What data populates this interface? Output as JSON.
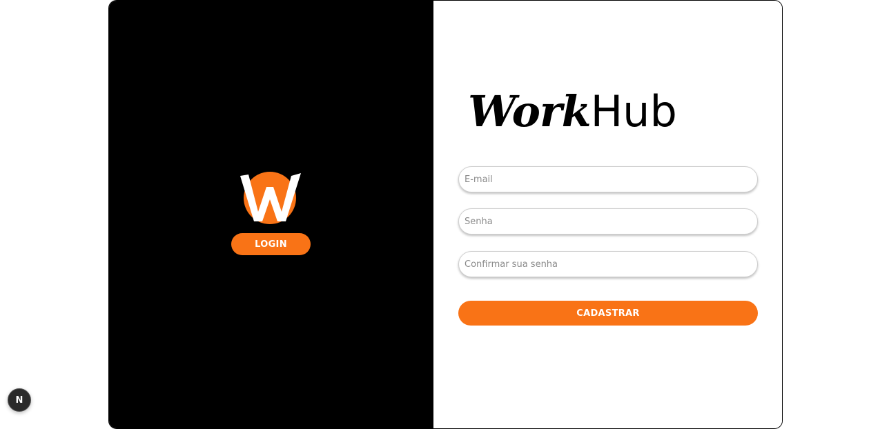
{
  "brand": {
    "name_bold": "Work",
    "name_light": "Hub",
    "accent_color": "#f97316",
    "logo_letter": "W"
  },
  "left_panel": {
    "login_label": "LOGIN"
  },
  "form": {
    "email_placeholder": "E-mail",
    "password_placeholder": "Senha",
    "confirm_placeholder": "Confirmar sua senha",
    "submit_label": "CADASTRAR"
  },
  "dev_badge": {
    "letter": "N",
    "icon": "nextjs-icon"
  }
}
